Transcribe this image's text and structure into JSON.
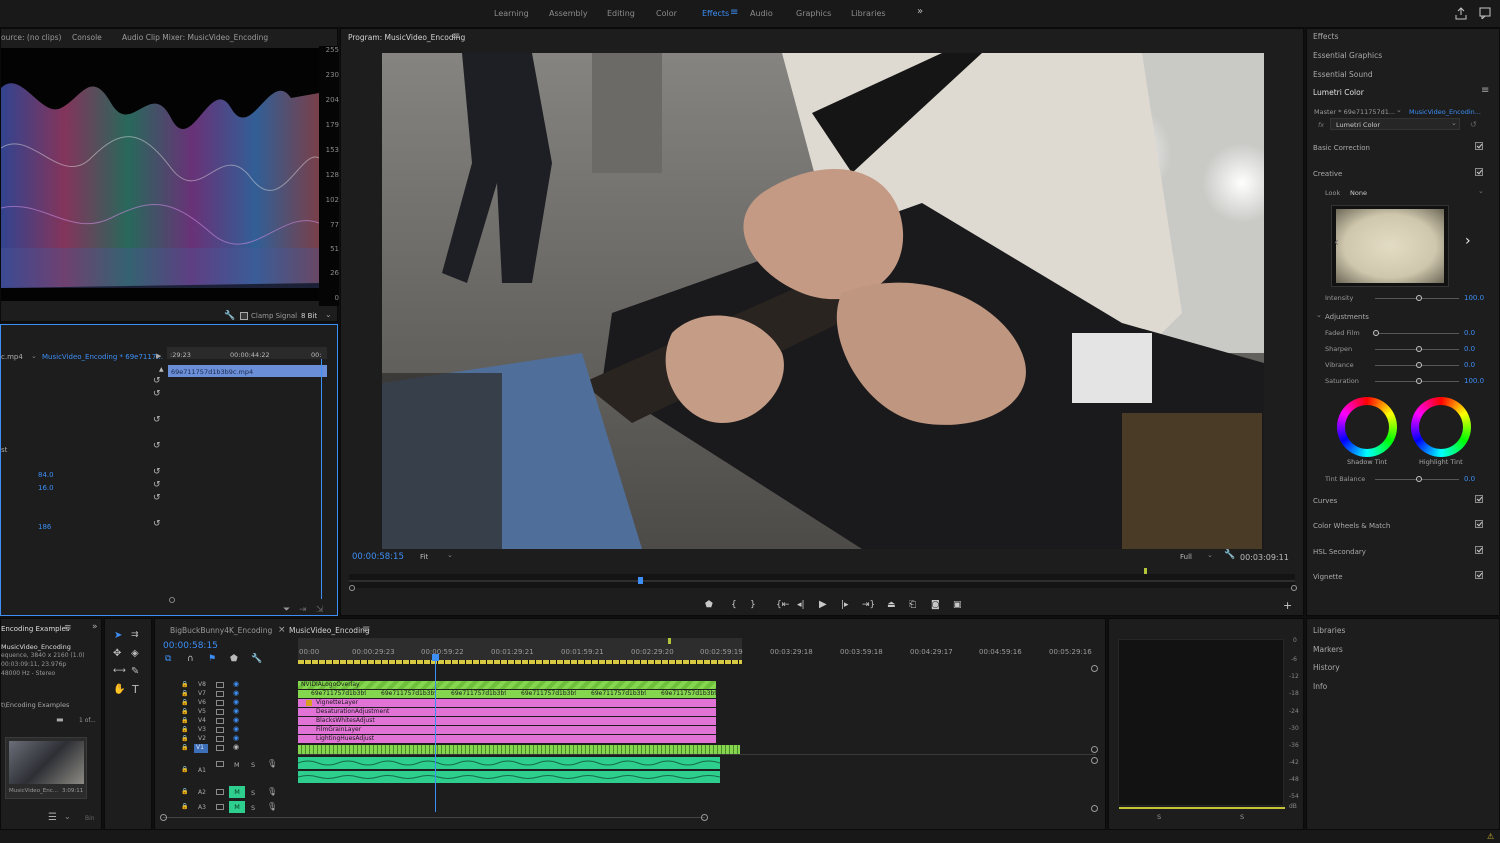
{
  "workspaces": [
    "Learning",
    "Assembly",
    "Editing",
    "Color",
    "Effects",
    "Audio",
    "Graphics",
    "Libraries"
  ],
  "workspace_active": "Effects",
  "more_workspaces": "»",
  "source_tabs": [
    "ource: (no clips)",
    "Console",
    "Audio Clip Mixer: MusicVideo_Encoding"
  ],
  "scope_scale": [
    "255",
    "230",
    "204",
    "179",
    "153",
    "128",
    "102",
    "77",
    "51",
    "26",
    "0"
  ],
  "scope_footer": {
    "clamp": "Clamp Signal",
    "bits": "8 Bit"
  },
  "effect_controls": {
    "clip": "c.mp4",
    "sequence": "MusicVideo_Encoding * 69e7117...",
    "time_start": ":29:23",
    "time_end": "00:00:44:22",
    "time_edge": "00:",
    "clip_bar": "69e711757d1b3b9c.mp4",
    "row_label_st": "st",
    "values": [
      "84.0",
      "16.0",
      "186"
    ]
  },
  "program": {
    "title": "Program: MusicVideo_Encoding",
    "timecode": "00:00:58:15",
    "fit": "Fit",
    "quality": "Full",
    "duration": "00:03:09:11"
  },
  "transport": [
    "marker",
    "in",
    "out",
    "go-in",
    "step-back",
    "play",
    "step-fwd",
    "go-out",
    "lift",
    "extract",
    "export-frame",
    "compare"
  ],
  "project": {
    "title": "Encoding Examples",
    "name": "MusicVideo_Encoding",
    "info1": "equence, 3840 x 2160 (1.0)",
    "info2": "00:03:09:11, 23.976p",
    "info3": "48000 Hz - Stereo",
    "path": "t\\Encoding Examples",
    "count": "1 of...",
    "thumb_label": "MusicVideo_Enc...",
    "thumb_dur": "3:09:11",
    "bin": "Bin"
  },
  "timeline": {
    "tabs": [
      "BigBuckBunny4K_Encoding",
      "MusicVideo_Encoding"
    ],
    "timecode": "00:00:58:15",
    "ruler": [
      "00:00",
      "00:00:29:23",
      "00:00:59:22",
      "00:01:29:21",
      "00:01:59:21",
      "00:02:29:20",
      "00:02:59:19",
      "00:03:29:18",
      "00:03:59:18",
      "00:04:29:17",
      "00:04:59:16",
      "00:05:29:16"
    ],
    "video_tracks": [
      "V8",
      "V7",
      "V6",
      "V5",
      "V4",
      "V3",
      "V2",
      "V1"
    ],
    "audio_tracks": [
      "A1",
      "A2",
      "A3"
    ],
    "clips": [
      {
        "label": "NVIDIALogoOverlay",
        "color": "#84d64f"
      },
      {
        "label": "69e711757d1b3b9",
        "color": "#84d64f"
      },
      {
        "label": "VignetteLayer",
        "color": "#e173d6"
      },
      {
        "label": "DesaturationAdjustment",
        "color": "#e173d6"
      },
      {
        "label": "BlacksWhitesAdjust",
        "color": "#e173d6"
      },
      {
        "label": "FilmGrainLayer",
        "color": "#e173d6"
      },
      {
        "label": "LightingHuesAdjust",
        "color": "#e173d6"
      }
    ],
    "v7_clip": "69e711757d1b3b9",
    "mute": "M",
    "solo": "S"
  },
  "audio_meter": {
    "scale": [
      "0",
      "-6",
      "-12",
      "-18",
      "-24",
      "-30",
      "-36",
      "-42",
      "-48",
      "-54",
      "dB"
    ],
    "channels": [
      "S",
      "S"
    ]
  },
  "right_panel": {
    "tabs": [
      "Effects",
      "Essential Graphics",
      "Essential Sound",
      "Lumetri Color"
    ],
    "master": "Master * 69e711757d1...",
    "master_seq": "MusicVideo_Encodin...",
    "fx_name": "Lumetri Color",
    "fx_prefix": "fx",
    "basic": "Basic Correction",
    "creative": "Creative",
    "look_label": "Look",
    "look_value": "None",
    "intensity_label": "Intensity",
    "intensity_value": "100.0",
    "adjustments": "Adjustments",
    "faded_label": "Faded Film",
    "faded_value": "0.0",
    "sharpen_label": "Sharpen",
    "sharpen_value": "0.0",
    "vibrance_label": "Vibrance",
    "vibrance_value": "0.0",
    "saturation_label": "Saturation",
    "saturation_value": "100.0",
    "shadow_tint": "Shadow Tint",
    "highlight_tint": "Highlight Tint",
    "tint_balance_label": "Tint Balance",
    "tint_balance_value": "0.0",
    "sections": [
      "Curves",
      "Color Wheels & Match",
      "HSL Secondary",
      "Vignette"
    ],
    "bottom_tabs": [
      "Libraries",
      "Markers",
      "History",
      "Info"
    ]
  },
  "colors": {
    "accent": "#3d8ef5",
    "green_clip": "#84d64f",
    "pink_clip": "#e173d6",
    "audio_clip": "#2ecf8e"
  }
}
